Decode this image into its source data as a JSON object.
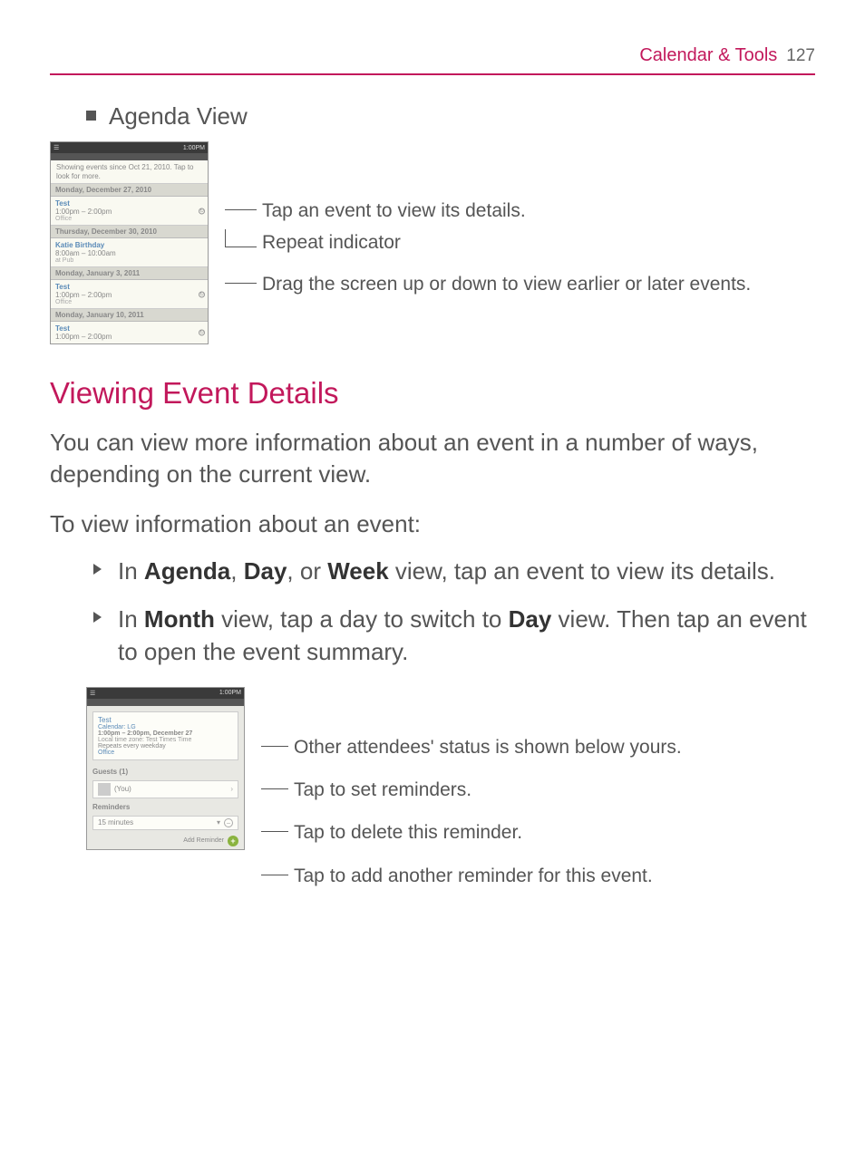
{
  "header": {
    "title": "Calendar & Tools",
    "page": "127"
  },
  "agenda_label": "Agenda View",
  "screenshot1": {
    "time_right": "1:00PM",
    "hint": "Showing events since Oct 21, 2010. Tap to look for more.",
    "groups": [
      {
        "date": "Monday, December 27, 2010",
        "events": [
          {
            "title": "Test",
            "time": "1:00pm – 2:00pm",
            "loc": "Office",
            "repeat": true
          }
        ]
      },
      {
        "date": "Thursday, December 30, 2010",
        "events": [
          {
            "title": "Katie Birthday",
            "time": "8:00am – 10:00am",
            "loc": "at Pub",
            "repeat": false
          }
        ]
      },
      {
        "date": "Monday, January 3, 2011",
        "events": [
          {
            "title": "Test",
            "time": "1:00pm – 2:00pm",
            "loc": "Office",
            "repeat": true
          }
        ]
      },
      {
        "date": "Monday, January 10, 2011",
        "events": [
          {
            "title": "Test",
            "time": "1:00pm – 2:00pm",
            "loc": "",
            "repeat": true
          }
        ]
      }
    ]
  },
  "anno1": {
    "tap": "Tap an event to view its details.",
    "repeat": "Repeat indicator",
    "drag": "Drag the screen up or down to view earlier or later events."
  },
  "section_heading": "Viewing Event Details",
  "body1": "You can view more information about an event in a number of ways, depending on the current view.",
  "subhead": "To view information about an event:",
  "li1_a": "In ",
  "li1_b": "Agenda",
  "li1_c": ", ",
  "li1_d": "Day",
  "li1_e": ", or ",
  "li1_f": "Week",
  "li1_g": " view, tap an event to view its details.",
  "li2_a": "In ",
  "li2_b": "Month",
  "li2_c": " view, tap a day to switch to ",
  "li2_d": "Day",
  "li2_e": " view. Then tap an event to open the event summary.",
  "screenshot2": {
    "time_right": "1:00PM",
    "event_title": "Test",
    "event_sub": "Calendar: LG",
    "event_detail": "1:00pm – 2:00pm, December 27",
    "event_zone": "Local time zone: Test Times Time",
    "event_rec": "Repeats every weekday",
    "event_loc": "Office",
    "guests_label": "Guests (1)",
    "guest_status": "(You)",
    "reminders_label": "Reminders",
    "reminder_value": "15 minutes",
    "add_label": "Add Reminder"
  },
  "anno2": {
    "attendees": "Other attendees' status is shown below yours.",
    "set": "Tap to set reminders.",
    "delete": "Tap to delete this reminder.",
    "add": "Tap to add another reminder for this event."
  }
}
